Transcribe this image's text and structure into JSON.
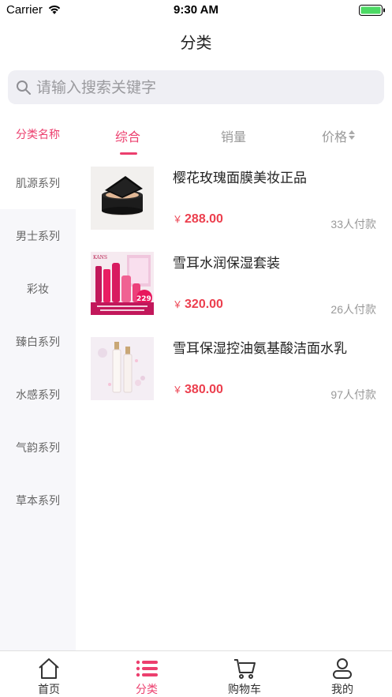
{
  "status_bar": {
    "carrier": "Carrier",
    "time": "9:30 AM"
  },
  "nav": {
    "title": "分类"
  },
  "search": {
    "placeholder": "请输入搜索关键字"
  },
  "sidebar": {
    "header": "分类名称",
    "items": [
      {
        "label": "肌源系列",
        "active": true
      },
      {
        "label": "男士系列"
      },
      {
        "label": "彩妆"
      },
      {
        "label": "臻白系列"
      },
      {
        "label": "水感系列"
      },
      {
        "label": "气韵系列"
      },
      {
        "label": "草本系列"
      }
    ]
  },
  "sort_tabs": {
    "comprehensive": "综合",
    "sales": "销量",
    "price": "价格"
  },
  "products": [
    {
      "name": "樱花玫瑰面膜美妆正品",
      "currency": "￥",
      "price": "288.00",
      "sales": "33人付款",
      "thumb": "cushion"
    },
    {
      "name": "雪耳水润保湿套装",
      "currency": "￥",
      "price": "320.00",
      "sales": "26人付款",
      "thumb": "set",
      "thumb_text": {
        "brand": "KANS",
        "promo": "229"
      }
    },
    {
      "name": "雪耳保湿控油氨基酸洁面水乳",
      "currency": "￥",
      "price": "380.00",
      "sales": "97人付款",
      "thumb": "bottle"
    }
  ],
  "tab_bar": {
    "items": [
      {
        "label": "首页",
        "icon": "home-icon"
      },
      {
        "label": "分类",
        "icon": "list-icon",
        "active": true
      },
      {
        "label": "购物车",
        "icon": "cart-icon"
      },
      {
        "label": "我的",
        "icon": "user-icon"
      }
    ]
  },
  "colors": {
    "accent": "#ec3f6e",
    "price": "#ec3f4e",
    "sidebar_bg": "#f7f7fa",
    "search_bg": "#efeff4"
  }
}
